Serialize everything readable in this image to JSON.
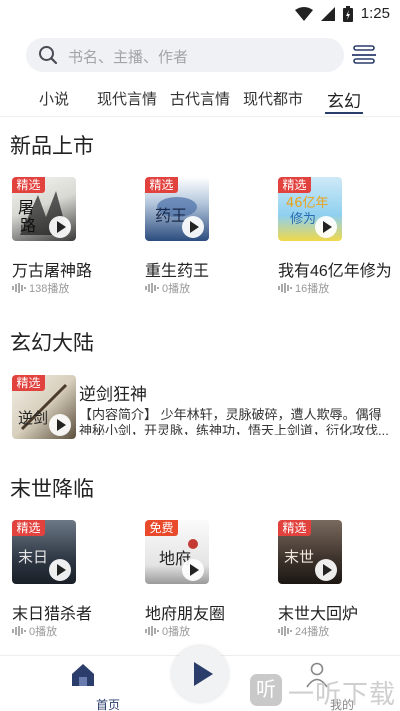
{
  "status_bar": {
    "time": "1:25"
  },
  "search": {
    "placeholder": "书名、主播、作者"
  },
  "tabs": [
    {
      "label": "小说",
      "active": false
    },
    {
      "label": "现代言情",
      "active": false
    },
    {
      "label": "古代言情",
      "active": false
    },
    {
      "label": "现代都市",
      "active": false
    },
    {
      "label": "玄幻",
      "active": true
    }
  ],
  "sections": [
    {
      "title": "新品上市",
      "books": [
        {
          "badge": "精选",
          "title": "万古屠神路",
          "plays": "138播放"
        },
        {
          "badge": "精选",
          "title": "重生药王",
          "plays": "0播放"
        },
        {
          "badge": "精选",
          "title": "我有46亿年修为",
          "plays": "16播放"
        }
      ]
    },
    {
      "title": "玄幻大陆",
      "feature": {
        "badge": "精选",
        "title": "逆剑狂神",
        "desc": "【内容简介】 少年林轩，灵脉破碎，遭人欺辱。偶得神秘小剑，开灵脉，练神功，悟天上剑道，衍化攻伐..."
      }
    },
    {
      "title": "末世降临",
      "books": [
        {
          "badge": "精选",
          "title": "末日猎杀者",
          "plays": "0播放"
        },
        {
          "badge": "免费",
          "title": "地府朋友圈",
          "plays": "0播放"
        },
        {
          "badge": "精选",
          "title": "末世大回炉",
          "plays": "24播放"
        }
      ]
    }
  ],
  "bottom_nav": {
    "home": "首页",
    "mine": "我的"
  },
  "watermark": {
    "logo": "听",
    "text": "一听下载"
  },
  "colors": {
    "accent": "#2b3d6b",
    "badge_red": "#e2423e"
  }
}
